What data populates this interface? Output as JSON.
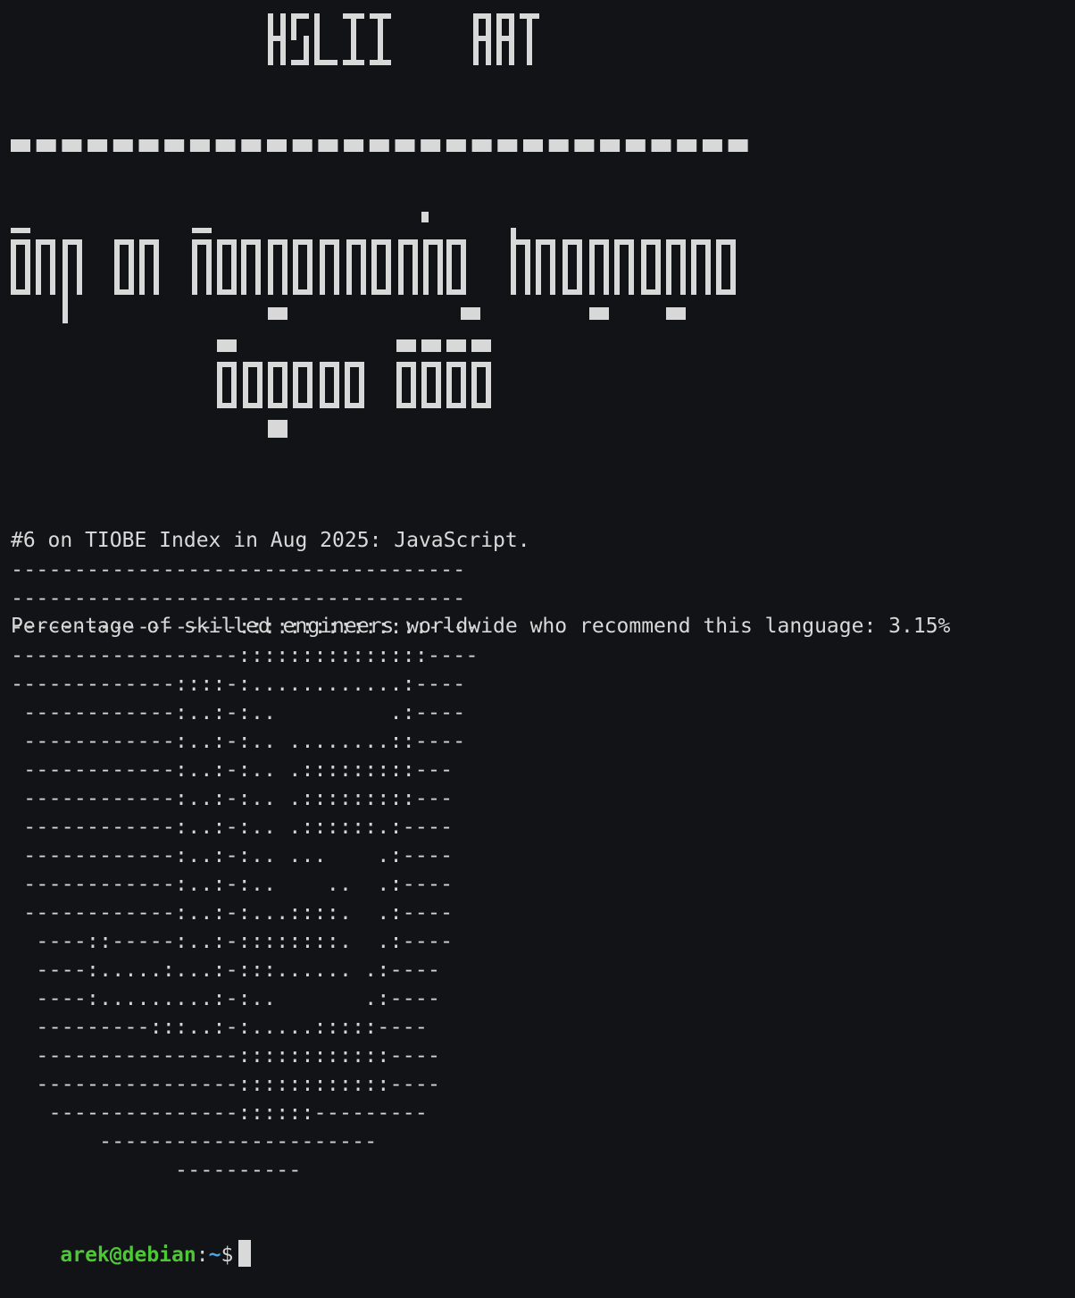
{
  "banner": {
    "line1": "ASCII ART",
    "line2": "Top 20 Programming Languages",
    "line3": "August 2025"
  },
  "info": {
    "rank_line": "#6 on TIOBE Index in Aug 2025: JavaScript.",
    "pct_line": "Percentage of skilled engineers worldwide who recommend this language: 3.15%"
  },
  "ascii_art": [
    "------------------------------------",
    "------------------------------------",
    "------------------:::::::::::::::----",
    "------------------:::::::::::::::----",
    "-------------::::-:............:----",
    " ------------:..:-:..         .:----",
    " ------------:..:-:.. ........::----",
    " ------------:..:-:.. .:::::::::---",
    " ------------:..:-:.. .:::::::::---",
    " ------------:..:-:.. .::::::.:----",
    " ------------:..:-:.. ...    .:----",
    " ------------:..:-:..    ..  .:----",
    " ------------:..:-:...::::.  .:----",
    "  ----::-----:..:-::::::::.  .:----",
    "  ----:.....:...:-:::...... .:----",
    "  ----:.........:-:..       .:----",
    "  ---------:::..:-:.....:::::----",
    "  ----------------::::::::::::----",
    "  ----------------::::::::::::----",
    "   ---------------::::::---------",
    "       ----------------------",
    "             ----------"
  ],
  "prompt": {
    "user": "arek@debian",
    "sep": ":",
    "path": "~",
    "dollar": "$"
  },
  "colors": {
    "background": "#121316",
    "text": "#d4d4d4",
    "prompt_user": "#4ec736",
    "prompt_path": "#4aa3e8"
  }
}
